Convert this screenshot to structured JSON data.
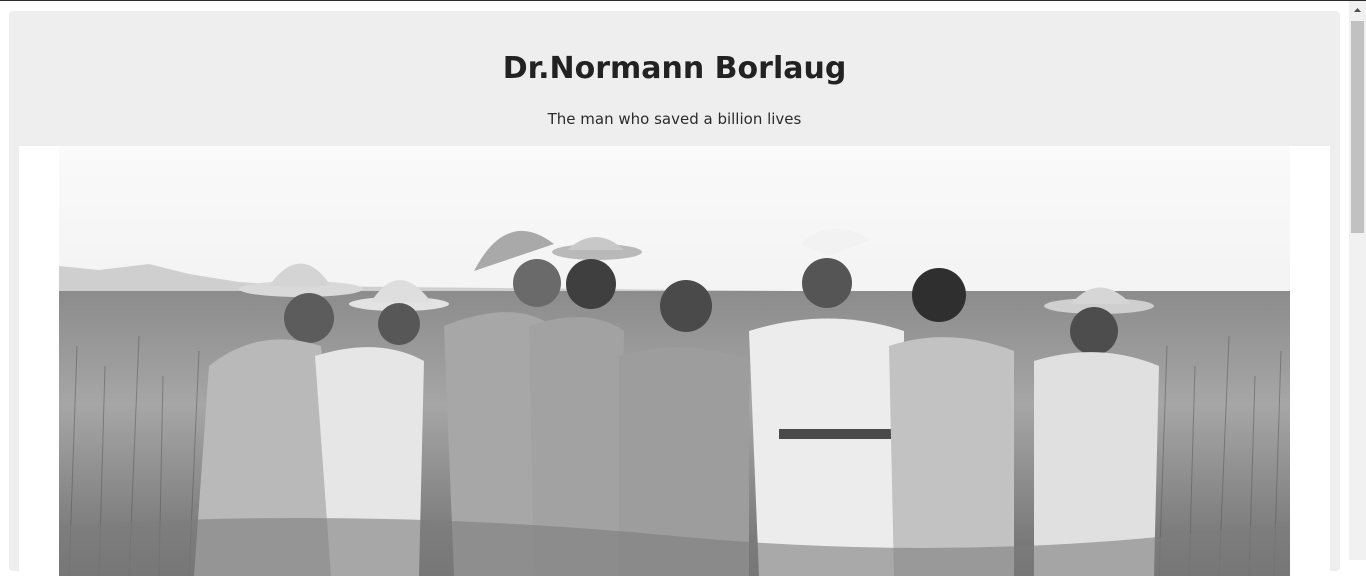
{
  "header": {
    "title": "Dr.Normann Borlaug",
    "subtitle": "The man who saved a billion lives"
  },
  "hero_image": {
    "icon": "photo-icon"
  },
  "colors": {
    "card_background": "#eeeeee",
    "title_text": "#222222",
    "scroll_thumb": "#c1c1c1"
  }
}
